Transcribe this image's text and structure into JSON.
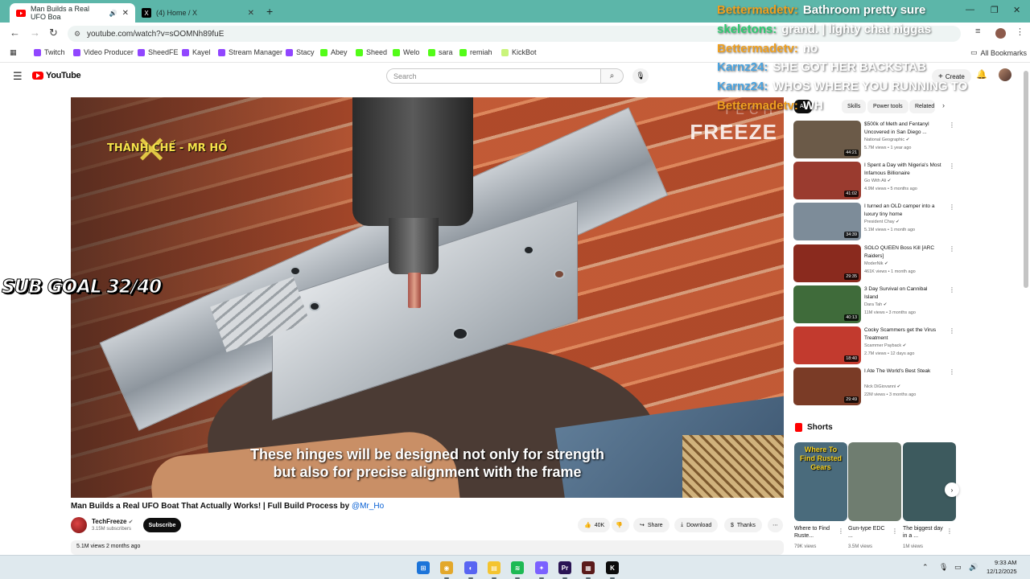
{
  "browser": {
    "tabs": [
      {
        "title": "Man Builds a Real UFO Boa",
        "active": true
      },
      {
        "title": "(4) Home / X",
        "active": false
      }
    ],
    "url": "youtube.com/watch?v=sOOMNh89fuE",
    "bookmarks": [
      {
        "label": "Twitch",
        "color": "#9146ff"
      },
      {
        "label": "Video Producer",
        "color": "#9146ff"
      },
      {
        "label": "SheedFE",
        "color": "#9146ff"
      },
      {
        "label": "Kayel",
        "color": "#9146ff"
      },
      {
        "label": "Stream Manager",
        "color": "#9146ff"
      },
      {
        "label": "Stacy",
        "color": "#9146ff"
      },
      {
        "label": "Abey",
        "color": "#53fc18"
      },
      {
        "label": "Sheed",
        "color": "#53fc18"
      },
      {
        "label": "Welo",
        "color": "#53fc18"
      },
      {
        "label": "sara",
        "color": "#53fc18"
      },
      {
        "label": "remiah",
        "color": "#53fc18"
      },
      {
        "label": "KickBot",
        "color": "#c9f47a"
      }
    ],
    "all_bookmarks": "All Bookmarks"
  },
  "youtube": {
    "logo_text": "YouTube",
    "search_placeholder": "Search",
    "create_label": "Create",
    "chips": [
      "All",
      "Skills",
      "Power tools",
      "Related"
    ],
    "video": {
      "watermark_left": "THÀNH CHẾ - MR HỒ",
      "watermark_right_small": "TECH",
      "watermark_right": "FREEZE",
      "subtitle_line1": "These hinges will be designed not only for strength",
      "subtitle_line2": "but also for precise alignment with the frame",
      "title": "Man Builds a Real UFO Boat That Actually Works! | Full Build Process by ",
      "title_mention": "@Mr_Ho",
      "channel": "TechFreeze",
      "subscribers": "3.15M subscribers",
      "subscribe_label": "Subscribe",
      "likes": "40K",
      "share_label": "Share",
      "download_label": "Download",
      "thanks_label": "Thanks",
      "views_age": "5.1M views  2 months ago"
    },
    "recommendations": [
      {
        "title": "$500k of Meth and Fentanyl Uncovered in San Diego ...",
        "channel": "National Geographic",
        "meta": "5.7M views • 1 year ago",
        "duration": "44:21",
        "thumb": "#6b5a48"
      },
      {
        "title": "I Spent a Day with Nigeria's Most Infamous Billionaire",
        "channel": "Go With Ali",
        "meta": "4.9M views • 5 months ago",
        "duration": "41:02",
        "thumb": "#9a3b2f"
      },
      {
        "title": "I turned an OLD camper into a luxury tiny home",
        "channel": "President Chay",
        "meta": "5.1M views • 1 month ago",
        "duration": "34:39",
        "thumb": "#7d8c99"
      },
      {
        "title": "SOLO QUEEN Boss Kill [ARC Raiders]",
        "channel": "ModerNik",
        "meta": "461K views • 1 month ago",
        "duration": "29:35",
        "thumb": "#8a2a1e"
      },
      {
        "title": "3 Day Survival on Cannibal Island",
        "channel": "Dara Tah",
        "meta": "11M views • 3 months ago",
        "duration": "40:13",
        "thumb": "#3f6b3a"
      },
      {
        "title": "Cocky Scammers get the Virus Treatment",
        "channel": "Scammer Payback",
        "meta": "2.7M views • 12 days ago",
        "duration": "18:40",
        "thumb": "#c23a2e"
      },
      {
        "title": "I Ate The World's Best Steak",
        "channel": "Nick DiGiovanni",
        "meta": "22M views • 3 months ago",
        "duration": "29:49",
        "thumb": "#7a3b26"
      }
    ],
    "shorts": {
      "heading": "Shorts",
      "items": [
        {
          "title": "Where to Find Ruste...",
          "views": "79K views",
          "overlay": "Where To Find Rusted Gears",
          "thumb": "#4a6b7c"
        },
        {
          "title": "Gun-type EDC ...",
          "views": "3.5M views",
          "overlay": "",
          "thumb": "#6f7d70"
        },
        {
          "title": "The biggest day in a ...",
          "views": "1M views",
          "overlay": "",
          "thumb": "#3d5a5e"
        }
      ]
    }
  },
  "overlay": {
    "sub_goal": "SUB GOAL 32/40",
    "chat": [
      {
        "user": "Bettermadetv:",
        "msg": "Bathroom pretty sure",
        "color": "#f0a020"
      },
      {
        "user": "skeletons:",
        "msg": "grand. | lighty chat niggas",
        "color": "#2ecc71"
      },
      {
        "user": "Bettermadetv:",
        "msg": "no",
        "color": "#f0a020"
      },
      {
        "user": "Karnz24:",
        "msg": "SHE GOT HER BACKSTAB",
        "color": "#4aa3df"
      },
      {
        "user": "Karnz24:",
        "msg": "WHOS WHERE YOU RUNNING TO",
        "color": "#4aa3df"
      },
      {
        "user": "Bettermadetv:",
        "msg": "WH",
        "color": "#f0a020"
      }
    ]
  },
  "taskbar": {
    "apps": [
      {
        "name": "windows-start",
        "color": "#1c74d9",
        "glyph": "⊞"
      },
      {
        "name": "chrome",
        "color": "#e3a82b",
        "glyph": "◉"
      },
      {
        "name": "discord",
        "color": "#5865f2",
        "glyph": "◐"
      },
      {
        "name": "file-explorer",
        "color": "#f4c430",
        "glyph": "▤"
      },
      {
        "name": "spotify",
        "color": "#1db954",
        "glyph": "≋"
      },
      {
        "name": "copilot",
        "color": "#7b61ff",
        "glyph": "✦"
      },
      {
        "name": "premiere",
        "color": "#2a1454",
        "glyph": "Pr"
      },
      {
        "name": "obs-app",
        "color": "#5a1a1a",
        "glyph": "▦"
      },
      {
        "name": "kick-app",
        "color": "#0b0b0b",
        "glyph": "K"
      }
    ],
    "time": "9:33 AM",
    "date": "12/12/2025"
  },
  "colors": {
    "tabstrip": "#5cb6a9",
    "youtube_red": "#ff0000",
    "link_blue": "#065fd4"
  }
}
